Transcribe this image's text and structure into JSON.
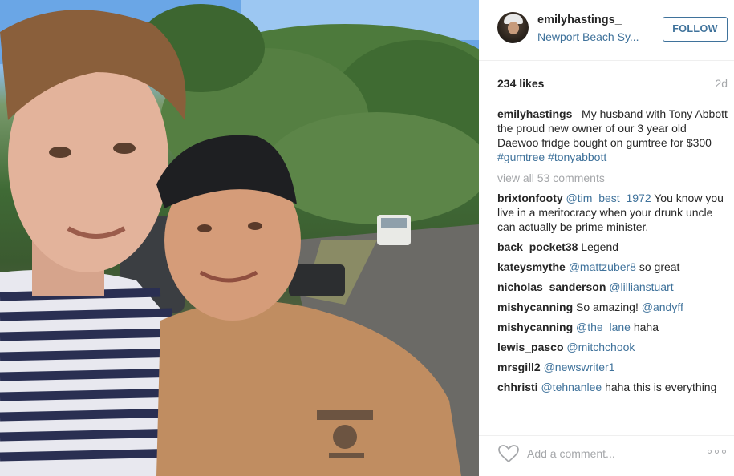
{
  "post": {
    "image_alt": "Selfie of two men outdoors on a suburban street"
  },
  "header": {
    "username": "emilyhastings_",
    "location": "Newport Beach Sy...",
    "follow_label": "FOLLOW"
  },
  "stats": {
    "likes": "234 likes",
    "time": "2d"
  },
  "caption": {
    "user": "emilyhastings_",
    "text": " My husband with Tony Abbott the proud new owner of our 3 year old Daewoo fridge bought on gumtree for $300 ",
    "tag1": "#gumtree",
    "tag2": "#tonyabbott"
  },
  "view_all": "view all 53 comments",
  "comments": [
    {
      "user": "brixtonfooty",
      "mention": "@tim_best_1972",
      "text": " You know you live in a meritocracy when your drunk uncle can actually be prime minister."
    },
    {
      "user": "back_pocket38",
      "mention": "",
      "text": " Legend"
    },
    {
      "user": "kateysmythe",
      "mention": "@mattzuber8",
      "text": " so great"
    },
    {
      "user": "nicholas_sanderson",
      "mention": "@lillianstuart",
      "text": ""
    },
    {
      "user": "mishycanning",
      "mention": "",
      "text": " So amazing! ",
      "mention_after": "@andyff"
    },
    {
      "user": "mishycanning",
      "mention": "@the_lane",
      "text": " haha"
    },
    {
      "user": "lewis_pasco",
      "mention": "@mitchchook",
      "text": ""
    },
    {
      "user": "mrsgill2",
      "mention": "@newswriter1",
      "text": ""
    },
    {
      "user": "chhristi",
      "mention": "@tehnanlee",
      "text": " haha this is everything"
    }
  ],
  "footer": {
    "placeholder": "Add a comment...",
    "heart_icon": "heart-outline-icon",
    "more_icon": "more-options-icon"
  },
  "colors": {
    "link": "#3f729b",
    "muted": "#a5a7aa",
    "text": "#262626",
    "border": "#efefef"
  }
}
